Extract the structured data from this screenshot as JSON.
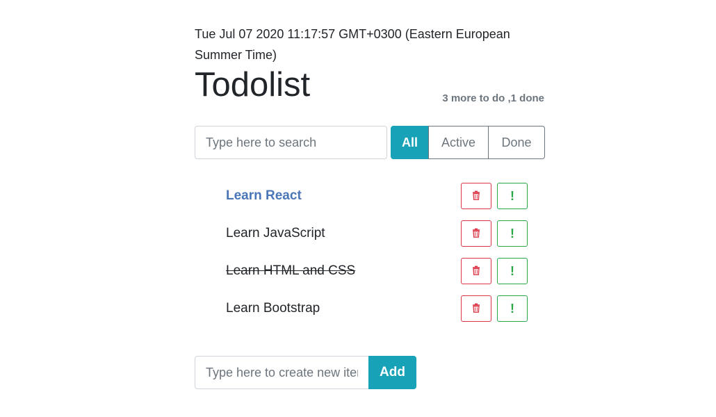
{
  "header": {
    "date": "Tue Jul 07 2020 11:17:57 GMT+0300 (Eastern European Summer Time)",
    "title": "Todolist",
    "count_text": "3 more to do ,1 done"
  },
  "search": {
    "placeholder": "Type here to search",
    "value": ""
  },
  "filters": [
    {
      "label": "All",
      "active": true
    },
    {
      "label": "Active",
      "active": false
    },
    {
      "label": "Done",
      "active": false
    }
  ],
  "todos": [
    {
      "label": "Learn React",
      "important": true,
      "done": false
    },
    {
      "label": "Learn JavaScript",
      "important": false,
      "done": false
    },
    {
      "label": "Learn HTML and CSS",
      "important": false,
      "done": true
    },
    {
      "label": "Learn Bootstrap",
      "important": false,
      "done": false
    }
  ],
  "todo_buttons": {
    "delete_icon": "trash-icon",
    "important_icon": "exclamation-icon",
    "important_glyph": "!"
  },
  "add_form": {
    "placeholder": "Type here to create new item",
    "value": "",
    "button_label": "Add"
  },
  "colors": {
    "accent": "#17a2b8",
    "danger": "#dc3545",
    "success": "#28a745",
    "important_text": "#4a76b8",
    "muted": "#6c757d"
  }
}
